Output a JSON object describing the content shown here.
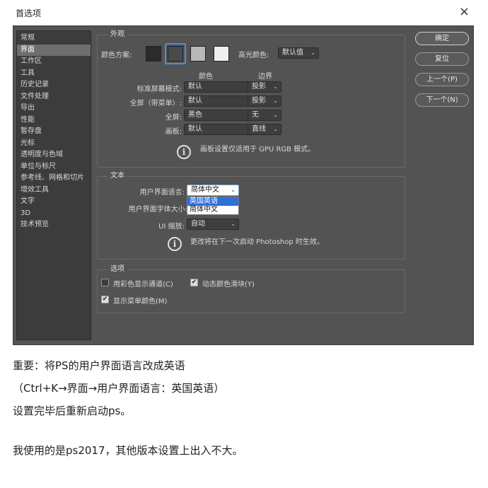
{
  "dialog": {
    "title": "首选项",
    "close": "×"
  },
  "sidebar": {
    "items": [
      {
        "label": "常规"
      },
      {
        "label": "界面"
      },
      {
        "label": "工作区"
      },
      {
        "label": "工具"
      },
      {
        "label": "历史记录"
      },
      {
        "label": "文件处理"
      },
      {
        "label": "导出"
      },
      {
        "label": "性能"
      },
      {
        "label": "暂存盘"
      },
      {
        "label": "光标"
      },
      {
        "label": "透明度与色域"
      },
      {
        "label": "单位与标尺"
      },
      {
        "label": "参考线、网格和切片"
      },
      {
        "label": "增效工具"
      },
      {
        "label": "文字"
      },
      {
        "label": "3D"
      },
      {
        "label": "技术预览"
      }
    ],
    "active_index": 1
  },
  "appearance": {
    "legend": "外观",
    "color_scheme_label": "颜色方案:",
    "swatches": [
      "#2b2b2b",
      "#4a4a4a",
      "#b8b8b8",
      "#eeeeee"
    ],
    "selected_swatch": 1,
    "highlight_label": "高光颜色:",
    "highlight_value": "默认值",
    "col_color": "颜色",
    "col_border": "边界",
    "rows": [
      {
        "label": "标准屏幕模式:",
        "color": "默认",
        "border": "投影"
      },
      {
        "label": "全屏（带菜单）:",
        "color": "默认",
        "border": "投影"
      },
      {
        "label": "全屏:",
        "color": "黑色",
        "border": "无"
      },
      {
        "label": "画板:",
        "color": "默认",
        "border": "直线"
      }
    ],
    "info_glyph": "i",
    "info_text": "画板设置仅适用于 GPU RGB 模式。"
  },
  "text_group": {
    "legend": "文本",
    "ui_language_label": "用户界面语言:",
    "ui_language_value": "简体中文",
    "ui_language_options": [
      "英国英语",
      "简体中文"
    ],
    "ui_language_highlighted": 0,
    "ui_font_size_label": "用户界面字体大小:",
    "ui_scale_label": "UI 缩放:",
    "ui_scale_value": "自动",
    "info_glyph": "i",
    "info_text": "更改将在下一次启动 Photoshop 时生效。"
  },
  "options_group": {
    "legend": "选项",
    "colored_channels": {
      "label": "用彩色显示通道(C)",
      "checked": false
    },
    "dynamic_sliders": {
      "label": "动态颜色滑块(Y)",
      "checked": true
    },
    "menu_colors": {
      "label": "显示菜单颜色(M)",
      "checked": true
    },
    "check_glyph": "✔"
  },
  "buttons": {
    "ok": "确定",
    "reset": "复位",
    "prev": "上一个(P)",
    "next": "下一个(N)"
  },
  "dropdown_glyph": "⌄",
  "note": {
    "line1": "重要：将PS的用户界面语言改成英语",
    "line2": "（Ctrl+K→界面→用户界面语言：英国英语）",
    "line3": "设置完毕后重新启动ps。",
    "line4": "我使用的是ps2017，其他版本设置上出入不大。"
  }
}
